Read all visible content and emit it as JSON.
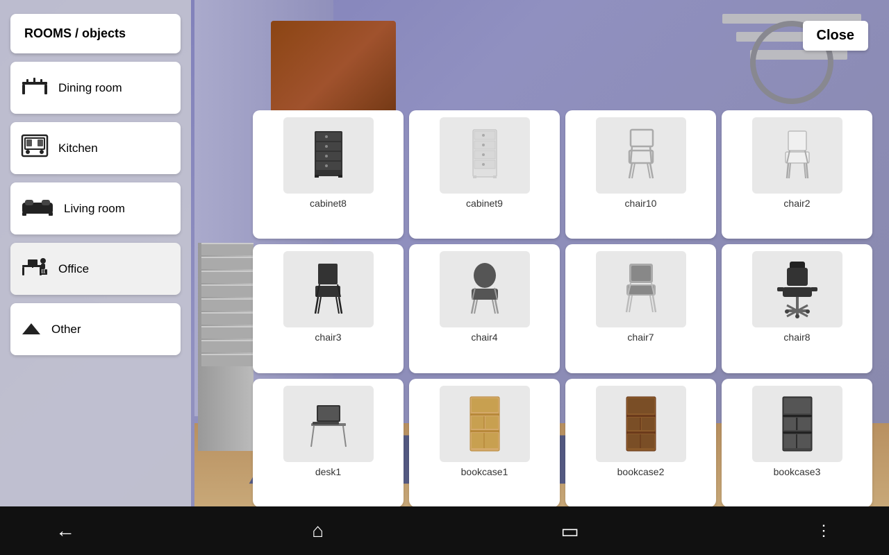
{
  "sidebar": {
    "title": "ROOMS / objects",
    "categories": [
      {
        "id": "dining-room",
        "label": "Dining room",
        "icon": "dining"
      },
      {
        "id": "kitchen",
        "label": "Kitchen",
        "icon": "kitchen"
      },
      {
        "id": "living-room",
        "label": "Living room",
        "icon": "living"
      },
      {
        "id": "office",
        "label": "Office",
        "icon": "office",
        "active": true
      },
      {
        "id": "other",
        "label": "Other",
        "icon": "other"
      }
    ]
  },
  "close_button": "Close",
  "items": [
    {
      "id": "cabinet8",
      "label": "cabinet8",
      "type": "cabinet-dark"
    },
    {
      "id": "cabinet9",
      "label": "cabinet9",
      "type": "cabinet-light"
    },
    {
      "id": "chair10",
      "label": "chair10",
      "type": "chair-wire"
    },
    {
      "id": "chair2",
      "label": "chair2",
      "type": "chair-simple-white"
    },
    {
      "id": "chair3",
      "label": "chair3",
      "type": "chair-black"
    },
    {
      "id": "chair4",
      "label": "chair4",
      "type": "chair-gray"
    },
    {
      "id": "chair7",
      "label": "chair7",
      "type": "chair-padded"
    },
    {
      "id": "chair8",
      "label": "chair8",
      "type": "chair-office"
    },
    {
      "id": "desk1",
      "label": "desk1",
      "type": "desk-simple"
    },
    {
      "id": "bookcase1",
      "label": "bookcase1",
      "type": "bookcase-light"
    },
    {
      "id": "bookcase2",
      "label": "bookcase2",
      "type": "bookcase-brown"
    },
    {
      "id": "bookcase3",
      "label": "bookcase3",
      "type": "bookcase-dark"
    }
  ],
  "nav": {
    "back_icon": "←",
    "home_icon": "⌂",
    "recents_icon": "▭",
    "menu_icon": "⋮"
  }
}
